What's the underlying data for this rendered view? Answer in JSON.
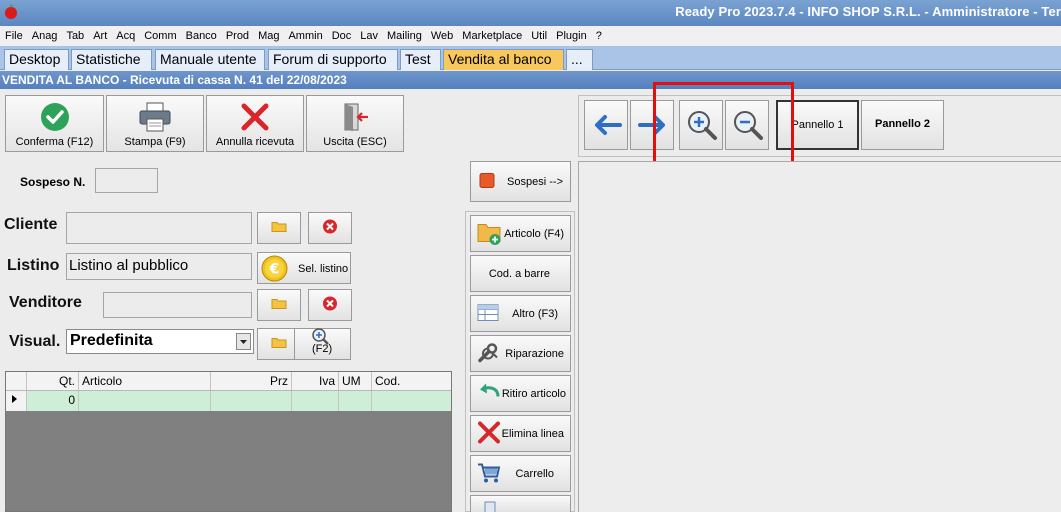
{
  "window": {
    "title": "Ready Pro 2023.7.4 - INFO SHOP S.R.L. - Amministratore - Ter"
  },
  "menu": [
    "File",
    "Anag",
    "Tab",
    "Art",
    "Acq",
    "Comm",
    "Banco",
    "Prod",
    "Mag",
    "Ammin",
    "Doc",
    "Lav",
    "Mailing",
    "Web",
    "Marketplace",
    "Util",
    "Plugin",
    "?"
  ],
  "tabs": [
    "Desktop",
    "Statistiche",
    "Manuale utente",
    "Forum di supporto",
    "Test",
    "Vendita al banco",
    "..."
  ],
  "header": {
    "title": "VENDITA AL BANCO - Ricevuta di cassa N. 41 del 22/08/2023"
  },
  "toolbar": {
    "confirm_label": "Conferma (F12)",
    "print_label": "Stampa (F9)",
    "cancel_label": "Annulla ricevuta",
    "exit_label": "Uscita (ESC)"
  },
  "right_toolbar": {
    "panel1_label": "Pannello 1",
    "panel2_label": "Pannello 2"
  },
  "form": {
    "suspended_label": "Sospeso N.",
    "suspended_value": "",
    "customer_label": "Cliente",
    "customer_value": "",
    "pricelist_label": "Listino",
    "pricelist_value": "Listino al pubblico",
    "select_pricelist_label": "Sel. listino",
    "seller_label": "Venditore",
    "seller_value": "",
    "view_label": "Visual.",
    "view_value": "Predefinita",
    "f2_label": "(F2)"
  },
  "grid": {
    "columns": [
      "Qt.",
      "Articolo",
      "Prz",
      "Iva",
      "UM",
      "Cod."
    ],
    "rows": [
      {
        "qty": "0",
        "article": "",
        "price": "",
        "vat": "",
        "um": "",
        "code": ""
      }
    ]
  },
  "side_buttons": {
    "suspended": "Sospesi -->",
    "article": "Articolo (F4)",
    "barcode": "Cod. a barre",
    "other": "Altro (F3)",
    "repair": "Riparazione",
    "return": "Ritiro articolo",
    "delete_line": "Elimina linea",
    "cart": "Carrello"
  },
  "colors": {
    "accent_tab": "#f8c85c",
    "title_blue": "#5b86c0",
    "highlight": "#e01010",
    "row_green": "#cfeed8"
  }
}
